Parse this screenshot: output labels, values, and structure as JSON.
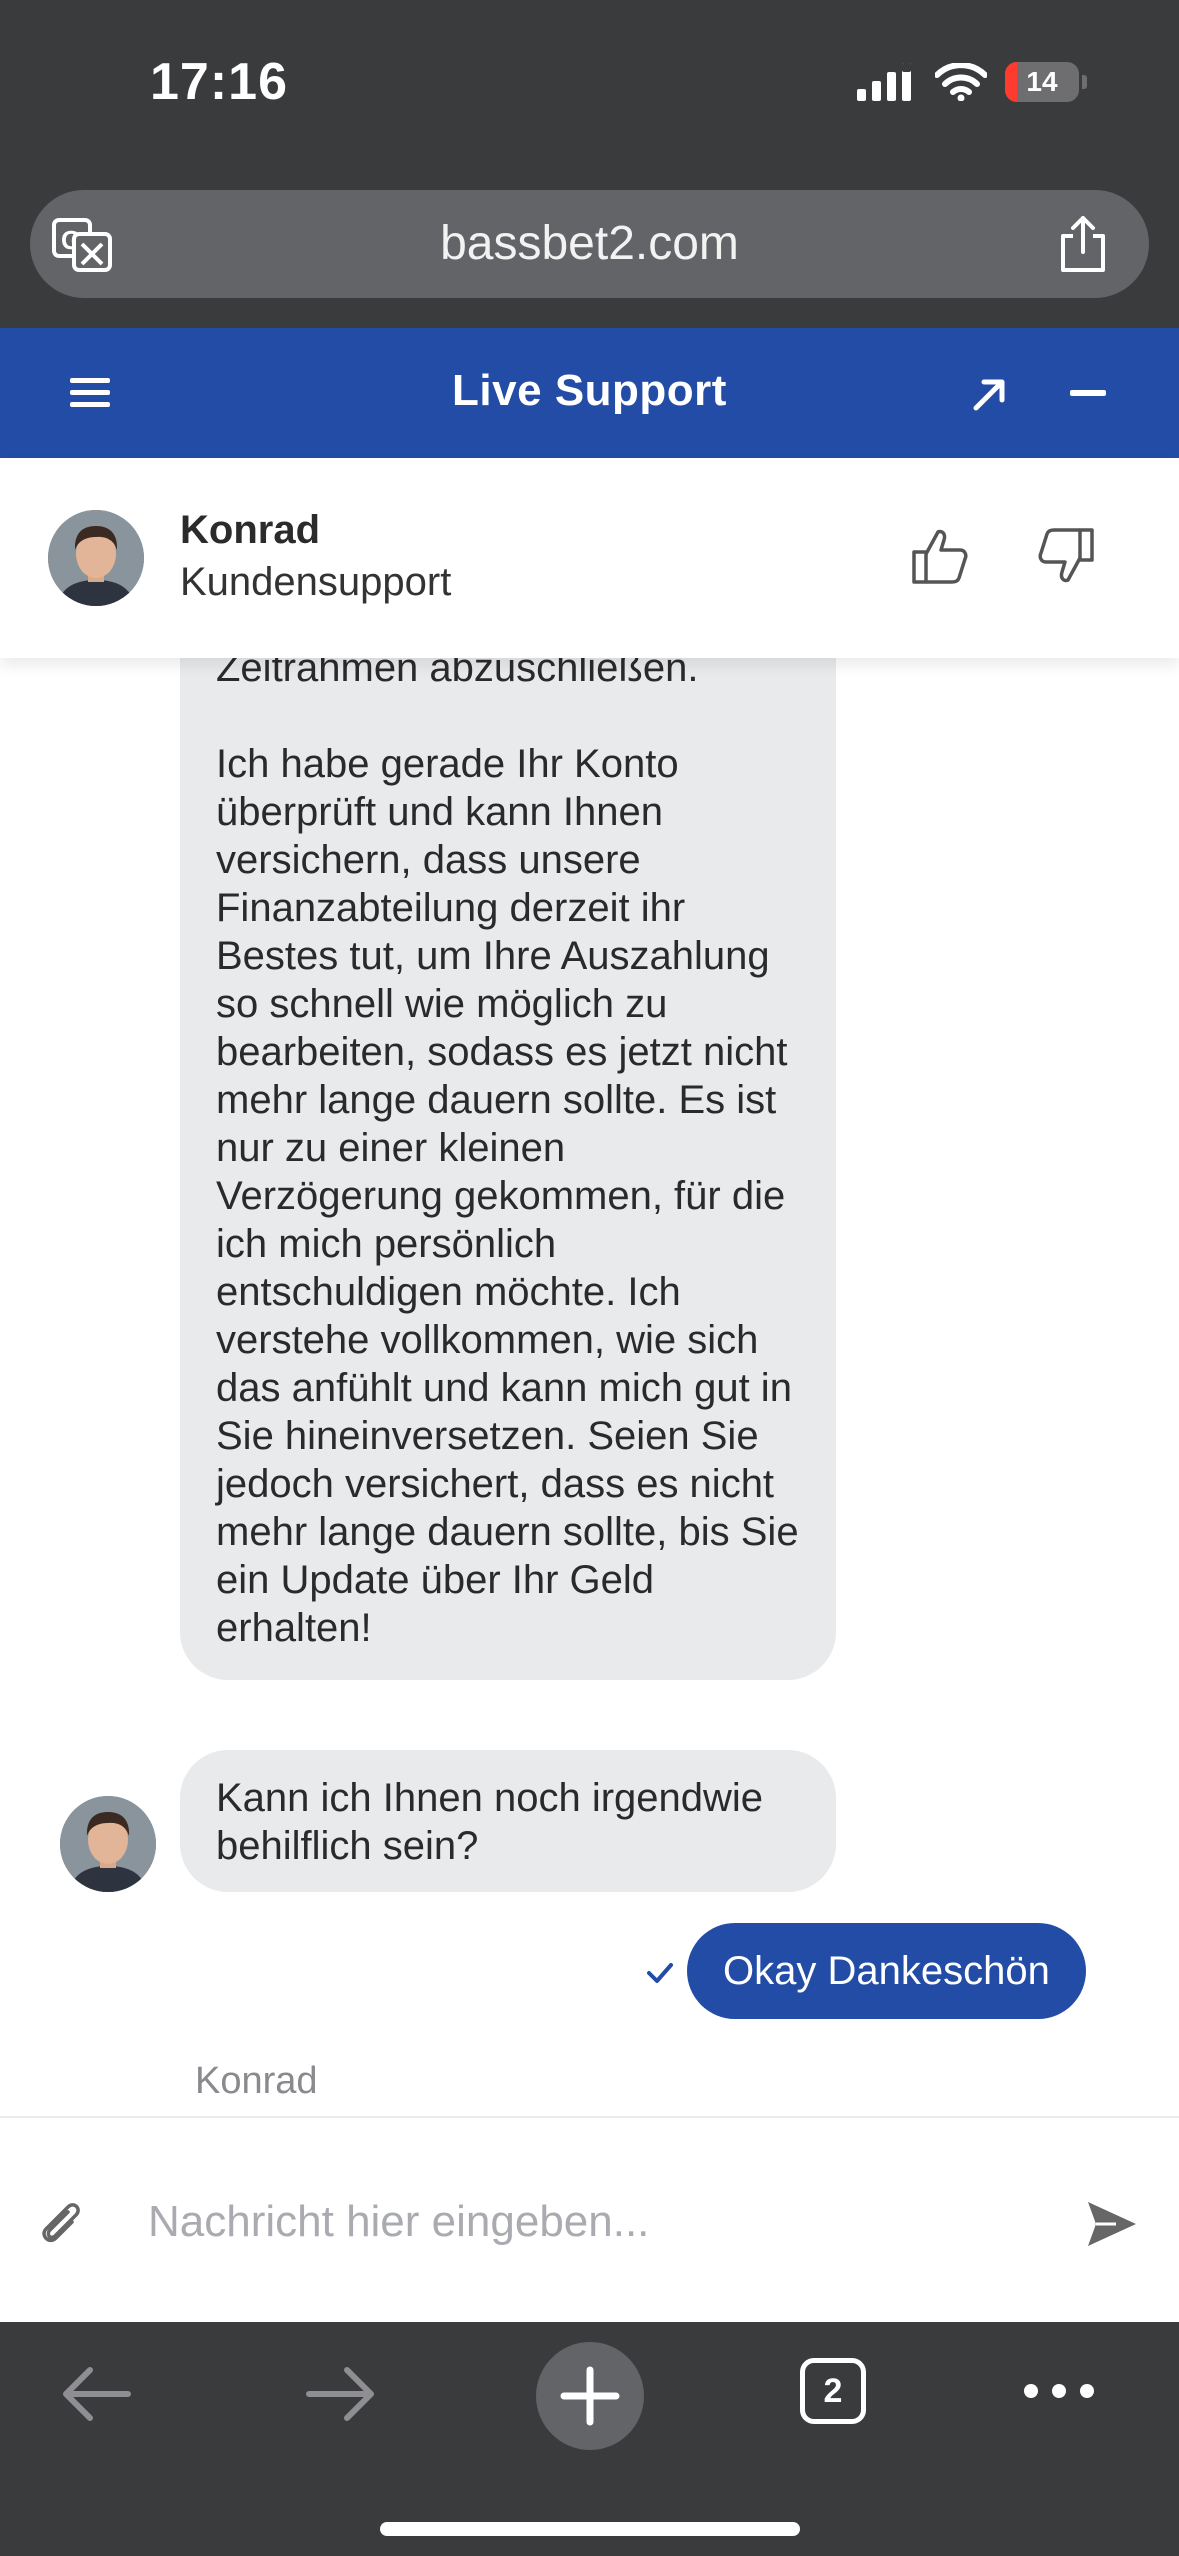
{
  "status_bar": {
    "time": "17:16",
    "battery": "14"
  },
  "browser": {
    "url": "bassbet2.com",
    "tab_count": "2"
  },
  "support_header": {
    "title": "Live Support"
  },
  "agent": {
    "name": "Konrad",
    "role": "Kundensupport"
  },
  "messages": [
    {
      "sender": "agent",
      "text": "Zeitrahmen abzuschließen.\n\nIch habe gerade Ihr Konto überprüft und kann Ihnen versichern, dass unsere Finanzabteilung derzeit ihr Bestes tut, um Ihre Auszahlung so schnell wie möglich zu bearbeiten, sodass es jetzt nicht mehr lange dauern sollte. Es ist nur zu einer kleinen Verzögerung gekommen, für die ich mich persönlich entschuldigen möchte. Ich verstehe vollkommen, wie sich das anfühlt und kann mich gut in Sie hineinversetzen. Seien Sie jedoch versichert, dass es nicht mehr lange dauern sollte, bis Sie ein Update über Ihr Geld erhalten!"
    },
    {
      "sender": "agent",
      "text": "Kann ich Ihnen noch irgendwie behilflich sein?"
    },
    {
      "sender": "user",
      "text": "Okay Dankeschön",
      "status": "sent"
    }
  ],
  "typing_indicator": {
    "name": "Konrad"
  },
  "composer": {
    "placeholder": "Nachricht hier eingeben..."
  },
  "colors": {
    "brand": "#224ca5",
    "agent_bubble": "#e9eaec",
    "browser_chrome": "#3a3b3d"
  }
}
